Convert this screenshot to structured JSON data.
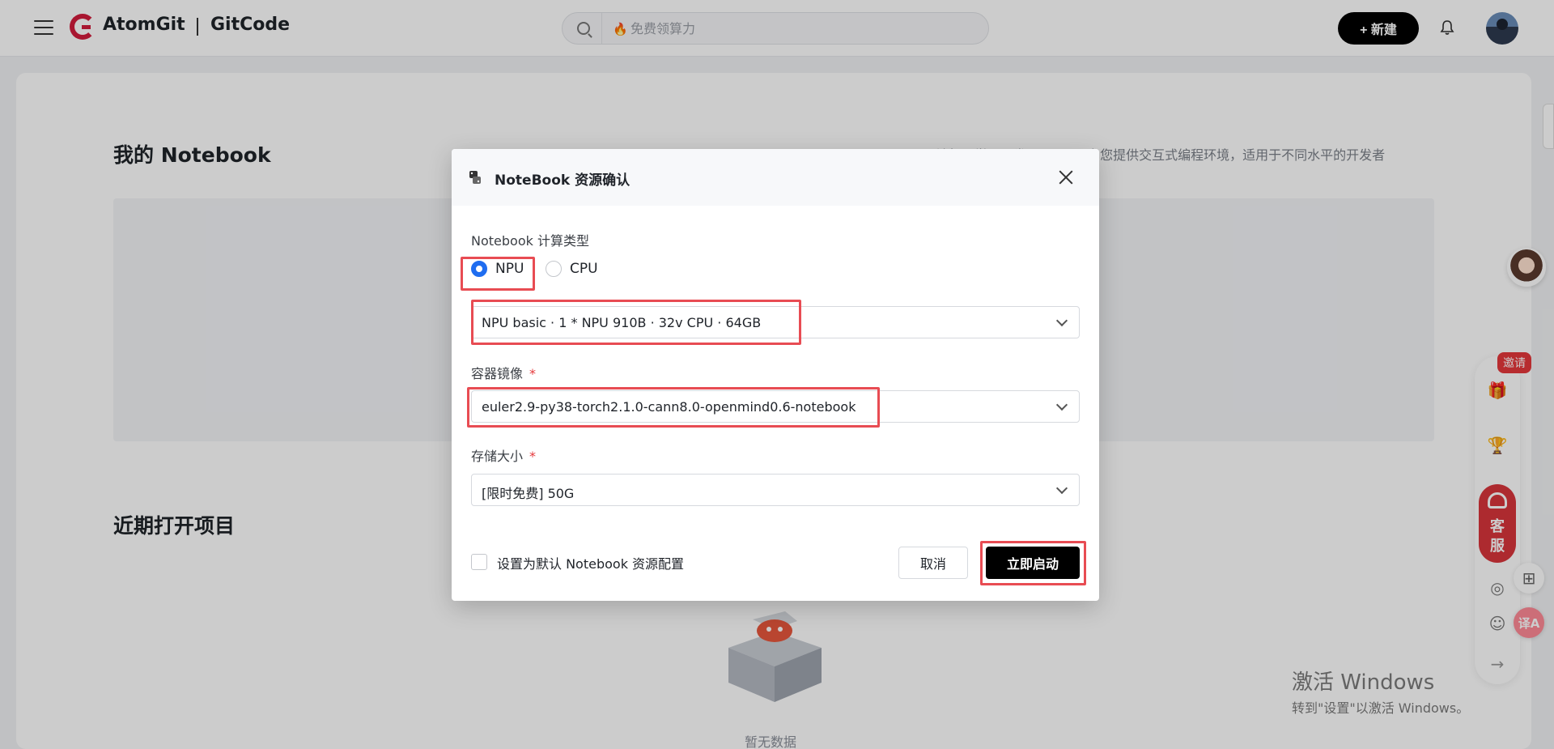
{
  "header": {
    "brand": "AtomGit",
    "brand2": "GitCode",
    "search_placeholder": "免费领算力",
    "new_button": "+ 新建"
  },
  "page": {
    "notebook_title": "我的 Notebook",
    "notebook_desc": "云端机器学习开发IDE工具，为您提供交互式编程环境，适用于不同水平的开发者",
    "recent_title": "近期打开项目",
    "empty_text": "暂无数据"
  },
  "side_tools": {
    "invite_badge": "邀请",
    "service_label_1": "客",
    "service_label_2": "服",
    "translate_label": "译A"
  },
  "watermark": {
    "line1": "激活 Windows",
    "line2": "转到\"设置\"以激活 Windows。"
  },
  "modal": {
    "title": "NoteBook 资源确认",
    "compute_type_label": "Notebook 计算类型",
    "radio_npu": "NPU",
    "radio_cpu": "CPU",
    "selected_type": "NPU",
    "spec_value": "NPU basic  ·  1 * NPU 910B  ·  32v CPU  ·  64GB",
    "image_label": "容器镜像",
    "image_value": "euler2.9-py38-torch2.1.0-cann8.0-openmind0.6-notebook",
    "storage_label": "存储大小",
    "storage_value": "[限时免费] 50G",
    "required_mark": "*",
    "default_checkbox_label": "设置为默认 Notebook 资源配置",
    "cancel_button": "取消",
    "start_button": "立即启动"
  }
}
